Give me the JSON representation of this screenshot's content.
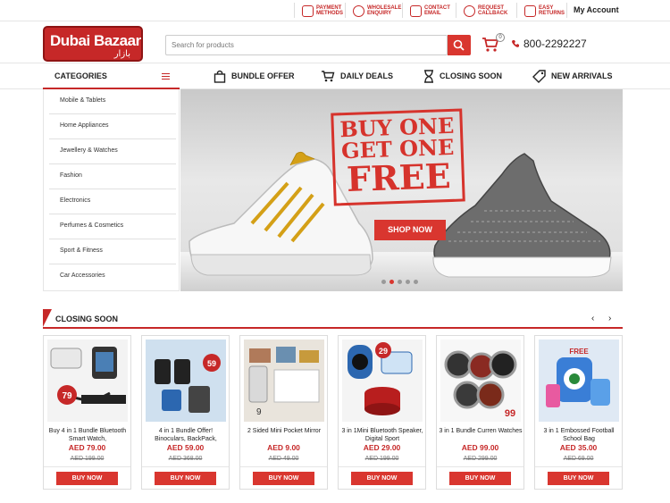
{
  "topbar": {
    "links": [
      {
        "label_1": "PAYMENT",
        "label_2": "METHODS",
        "icon": "card-icon"
      },
      {
        "label_1": "WHOLESALE",
        "label_2": "ENQUIRY",
        "icon": "truck-icon"
      },
      {
        "label_1": "CONTACT",
        "label_2": "EMAIL",
        "icon": "mail-icon"
      },
      {
        "label_1": "REQUEST",
        "label_2": "CALLBACK",
        "icon": "headset-icon"
      },
      {
        "label_1": "EASY",
        "label_2": "RETURNS",
        "icon": "return-icon"
      }
    ],
    "account": "My Account"
  },
  "header": {
    "logo_main": "Dubai Bazaar",
    "logo_arabic": "بازار",
    "search_placeholder": "Search for products",
    "cart_count": "0",
    "phone": "800-2292227"
  },
  "nav": {
    "categories_label": "CATEGORIES",
    "items": [
      {
        "label": "BUNDLE OFFER",
        "icon": "bag-icon"
      },
      {
        "label": "DAILY DEALS",
        "icon": "cart-icon"
      },
      {
        "label": "CLOSING SOON",
        "icon": "hourglass-icon"
      },
      {
        "label": "NEW ARRIVALS",
        "icon": "tag-icon"
      }
    ]
  },
  "categories": [
    "Mobile & Tablets",
    "Home Appliances",
    "Jewellery & Watches",
    "Fashion",
    "Electronics",
    "Perfumes & Cosmetics",
    "Sport & Fitness",
    "Car Accessories"
  ],
  "banner": {
    "line1": "BUY ONE",
    "line2": "GET ONE",
    "line3": "FREE",
    "button": "SHOP NOW",
    "slides": 5,
    "active_slide": 2
  },
  "closing_soon": {
    "title": "CLOSING SOON",
    "prev": "‹",
    "next": "›",
    "products": [
      {
        "name": "Buy 4 in 1 Bundle Bluetooth Smart Watch,",
        "price": "AED 79.00",
        "old_price": "AED 199.00",
        "button": "BUY NOW",
        "badge": "79"
      },
      {
        "name": "4 in 1 Bundle Offer! Binoculars, BackPack,",
        "price": "AED 59.00",
        "old_price": "AED 368.00",
        "button": "BUY NOW",
        "badge": "59"
      },
      {
        "name": "2 Sided Mini Pocket Mirror",
        "price": "AED 9.00",
        "old_price": "AED 49.00",
        "button": "BUY NOW",
        "badge": "9"
      },
      {
        "name": "3 in 1Mini Bluetooth Speaker, Digital Sport",
        "price": "AED 29.00",
        "old_price": "AED 199.00",
        "button": "BUY NOW",
        "badge": "29"
      },
      {
        "name": "3 in 1 Bundle Curren Watches",
        "price": "AED 99.00",
        "old_price": "AED 299.00",
        "button": "BUY NOW",
        "badge": "99"
      },
      {
        "name": "3 in 1 Embossed Football School Bag",
        "price": "AED 35.00",
        "old_price": "AED 69.00",
        "button": "BUY NOW",
        "badge": "FREE"
      }
    ]
  },
  "colors": {
    "brand_red": "#d9362f",
    "dark_red": "#c62828"
  }
}
